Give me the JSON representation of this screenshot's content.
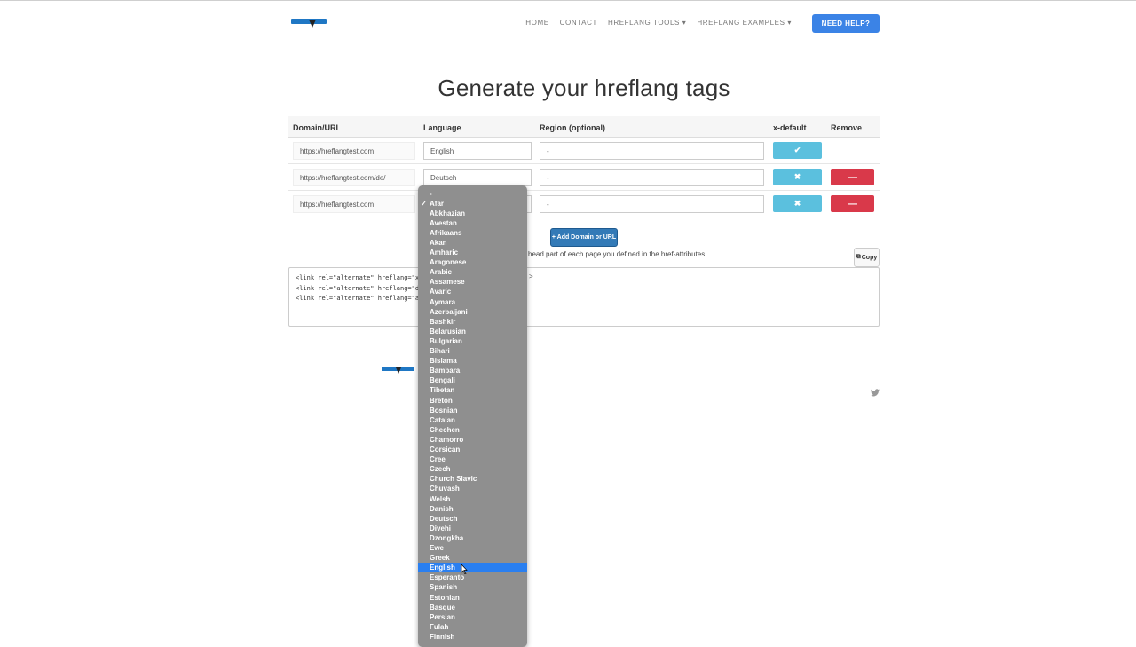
{
  "nav": {
    "home": "HOME",
    "contact": "CONTACT",
    "tools": "HREFLANG TOOLS",
    "examples": "HREFLANG EXAMPLES",
    "help": "NEED HELP?"
  },
  "title": "Generate your hreflang tags",
  "table": {
    "headers": {
      "domain": "Domain/URL",
      "language": "Language",
      "region": "Region (optional)",
      "xdefault": "x-default",
      "remove": "Remove"
    },
    "rows": [
      {
        "url": "https://hreflangtest.com",
        "language": "English",
        "region": "-",
        "xdefault_icon": "✔"
      },
      {
        "url": "https://hreflangtest.com/de/",
        "language": "Deutsch",
        "region": "-",
        "xdefault_icon": "✖",
        "remove_icon": "—"
      },
      {
        "url": "https://hreflangtest.com",
        "language": "",
        "region": "-",
        "xdefault_icon": "✖",
        "remove_icon": "—"
      }
    ]
  },
  "add_button": "+ Add Domain or URL",
  "instruction": "head part of each page you defined in the href-attributes:",
  "copy_button": "Copy",
  "code_lines": [
    "<link rel=\"alternate\" hreflang=\"x-defau",
    "<link rel=\"alternate\" hreflang=\"de\" href",
    "<link rel=\"alternate\" hreflang=\"aa\" href"
  ],
  "code_trailing": ">",
  "dropdown": {
    "placeholder": "-",
    "checked": "Afar",
    "selected": "English",
    "options": [
      "Afar",
      "Abkhazian",
      "Avestan",
      "Afrikaans",
      "Akan",
      "Amharic",
      "Aragonese",
      "Arabic",
      "Assamese",
      "Avaric",
      "Aymara",
      "Azerbaijani",
      "Bashkir",
      "Belarusian",
      "Bulgarian",
      "Bihari",
      "Bislama",
      "Bambara",
      "Bengali",
      "Tibetan",
      "Breton",
      "Bosnian",
      "Catalan",
      "Chechen",
      "Chamorro",
      "Corsican",
      "Cree",
      "Czech",
      "Church Slavic",
      "Chuvash",
      "Welsh",
      "Danish",
      "Deutsch",
      "Divehi",
      "Dzongkha",
      "Ewe",
      "Greek",
      "English",
      "Esperanto",
      "Spanish",
      "Estonian",
      "Basque",
      "Persian",
      "Fulah",
      "Finnish"
    ]
  },
  "icons": {
    "twitter": "twitter-icon",
    "check": "check-icon",
    "times": "times-icon",
    "minus": "minus-icon",
    "copy": "copy-icon"
  },
  "colors": {
    "primary": "#3b83e6",
    "info": "#5bc0de",
    "danger": "#d9394a",
    "select": "#2a7ff0"
  }
}
